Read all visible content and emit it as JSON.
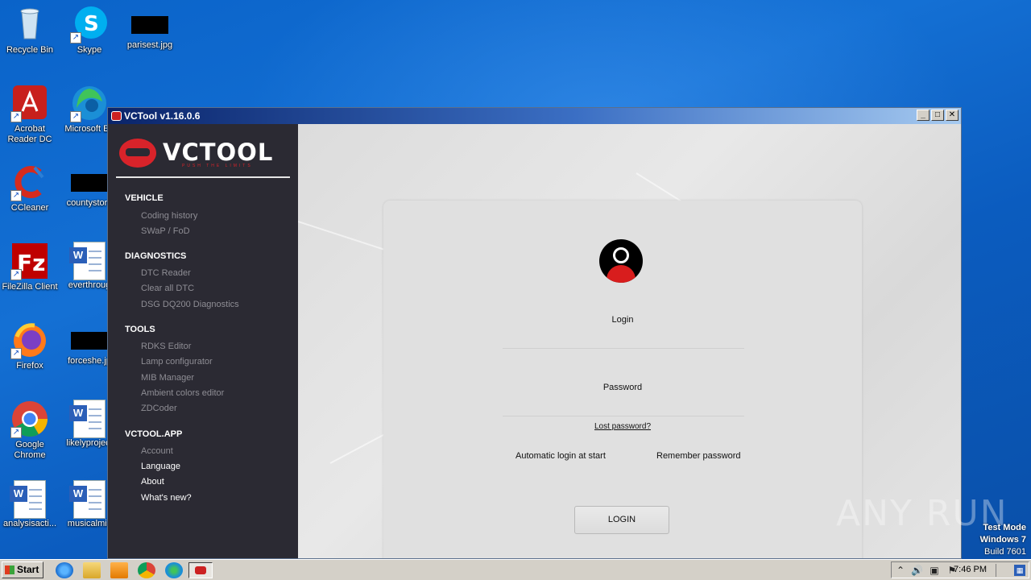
{
  "desktop": {
    "icons": [
      {
        "label": "Recycle Bin",
        "icon": "recycle-bin-icon"
      },
      {
        "label": "Skype",
        "icon": "skype-icon"
      },
      {
        "label": "parisest.jpg",
        "icon": "image-file-icon"
      },
      {
        "label": "Acrobat Reader DC",
        "icon": "acrobat-reader-icon"
      },
      {
        "label": "Microsoft Ed",
        "icon": "edge-icon"
      },
      {
        "label": "CCleaner",
        "icon": "ccleaner-icon"
      },
      {
        "label": "countystore",
        "icon": "file-icon"
      },
      {
        "label": "FileZilla Client",
        "icon": "filezilla-icon"
      },
      {
        "label": "everthroug",
        "icon": "word-doc-icon"
      },
      {
        "label": "Firefox",
        "icon": "firefox-icon"
      },
      {
        "label": "forceshe.jp",
        "icon": "image-file-icon"
      },
      {
        "label": "Google Chrome",
        "icon": "chrome-icon"
      },
      {
        "label": "likelyproject",
        "icon": "word-doc-icon"
      },
      {
        "label": "analysisacti...",
        "icon": "word-doc-icon"
      },
      {
        "label": "musicalmic",
        "icon": "word-doc-icon"
      }
    ],
    "watermark": "ANY RUN",
    "test_mode": {
      "line1": "Test Mode",
      "line2": "Windows 7",
      "line3": "Build 7601"
    }
  },
  "window": {
    "title": "VCTool v1.16.0.6",
    "controls": {
      "minimize": "_",
      "maximize": "□",
      "close": "✕"
    }
  },
  "sidebar": {
    "logo_text": "VCTOOL",
    "logo_tagline": "PUSH THE LIMITS",
    "sections": [
      {
        "title": "VEHICLE",
        "items": [
          "Coding history",
          "SWaP / FoD"
        ]
      },
      {
        "title": "DIAGNOSTICS",
        "items": [
          "DTC Reader",
          "Clear all DTC",
          "DSG DQ200 Diagnostics"
        ]
      },
      {
        "title": "TOOLS",
        "items": [
          "RDKS Editor",
          "Lamp configurator",
          "MIB Manager",
          "Ambient colors editor",
          "ZDCoder"
        ]
      },
      {
        "title": "VCTOOL.APP",
        "items": [
          "Account",
          "Language",
          "About",
          "What's new?"
        ]
      }
    ]
  },
  "login": {
    "login_placeholder": "Login",
    "password_placeholder": "Password",
    "lost_password": "Lost password?",
    "auto_login": "Automatic login at start",
    "remember_password": "Remember password",
    "button": "LOGIN"
  },
  "taskbar": {
    "start": "Start",
    "clock": "7:46 PM",
    "apps": [
      "ie-icon",
      "explorer-icon",
      "media-player-icon",
      "chrome-icon",
      "edge-icon",
      "vctool-icon"
    ]
  },
  "colors": {
    "accent": "#d8232a",
    "sidebar_bg": "#2b2a33",
    "desktop_bg": "#1470d4"
  }
}
